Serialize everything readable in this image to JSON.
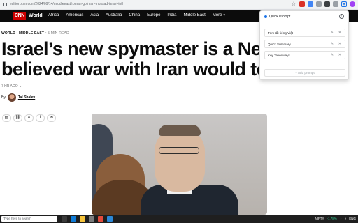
{
  "browser": {
    "url": "edition.cnn.com/2024/09/14/middleeast/roman-gofman-mossad-israel-intl"
  },
  "nav": {
    "logo": "CNN",
    "section": "World",
    "items": [
      "Africa",
      "Americas",
      "Asia",
      "Australia",
      "China",
      "Europe",
      "India",
      "Middle East"
    ],
    "more_label": "More"
  },
  "article": {
    "breadcrumb_world": "WORLD",
    "breadcrumb_section": "MIDDLE EAST",
    "read_time": "5 MIN READ",
    "headline_line1": "Israel’s new spymaster is a Netanya",
    "headline_line2": "believed war with Iran would topple",
    "timestamp": "7 HR AGO",
    "byline_prefix": "By",
    "author": "Tal Shalev"
  },
  "quick_prompt": {
    "title": "Quick Prompt",
    "items": [
      "Tóm tắt tiếng Việt",
      "Quick Summary",
      "Key Takeaways"
    ],
    "add_label": "+ Add prompt"
  },
  "taskbar": {
    "search_placeholder": "Type here to search",
    "indices_label": "NIFTY",
    "indices_change": "-1.78%",
    "language": "ENG"
  },
  "colors": {
    "cnn_red": "#cc0000",
    "nav_bg": "#0c0c0c",
    "accent_blue": "#1a73e8"
  }
}
